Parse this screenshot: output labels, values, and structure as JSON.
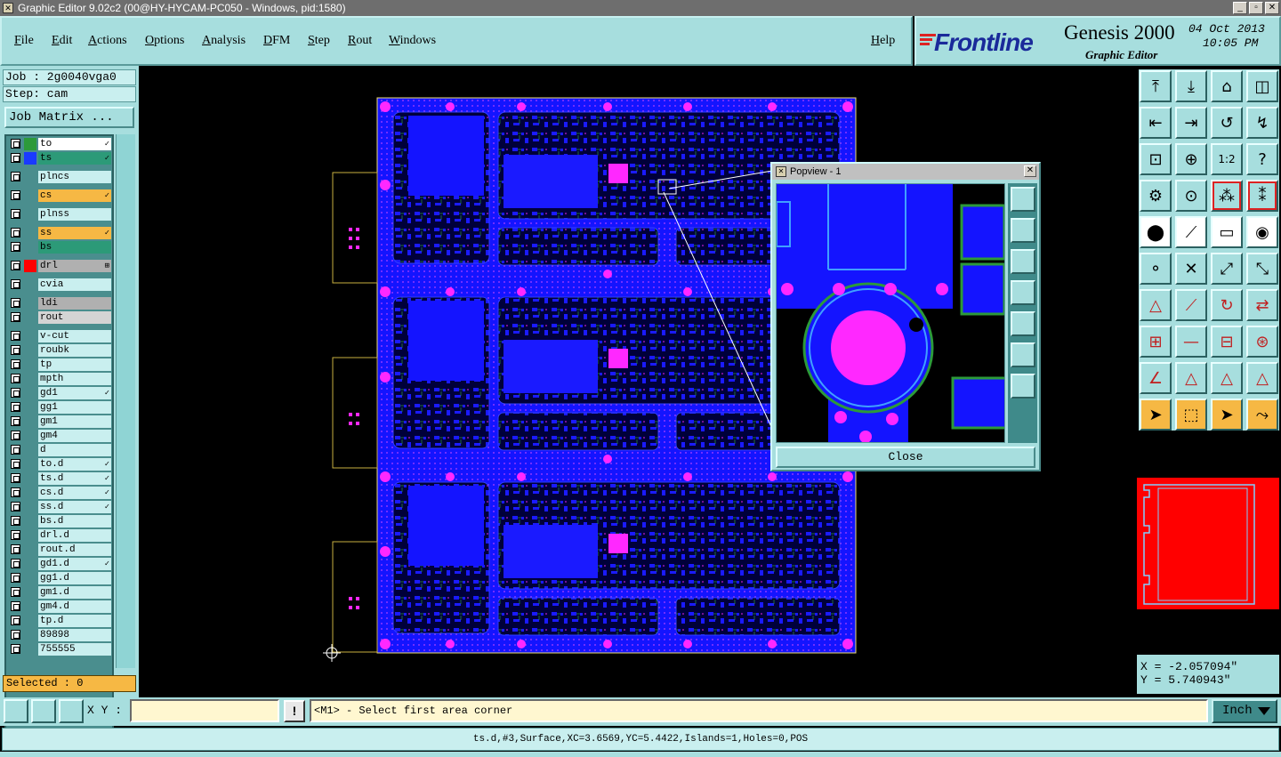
{
  "window": {
    "title": "Graphic Editor 9.02c2 (00@HY-HYCAM-PC050 - Windows, pid:1580)",
    "buttons": [
      "_",
      "▫",
      "✕"
    ]
  },
  "menu": {
    "items": [
      "File",
      "Edit",
      "Actions",
      "Options",
      "Analysis",
      "DFM",
      "Step",
      "Rout",
      "Windows"
    ],
    "help": "Help"
  },
  "brand": {
    "logo": "Frontline",
    "product": "Genesis 2000",
    "subtitle": "Graphic Editor",
    "date": "04 Oct 2013",
    "time": "10:05 PM"
  },
  "job": {
    "job_label": "Job : 2g0040vga0",
    "step_label": "Step: cam",
    "matrix_button": "Job Matrix ..."
  },
  "layers": [
    {
      "name": "to",
      "style": "white",
      "swatch": "#2c9a3a",
      "flag": "✓"
    },
    {
      "name": "ts",
      "style": "green",
      "swatch": "#1a3aff",
      "flag": "✓"
    },
    {
      "name": "plncs",
      "style": "normal",
      "swatch": "",
      "flag": ""
    },
    {
      "name": "cs",
      "style": "orange",
      "swatch": "",
      "flag": "✓"
    },
    {
      "name": "plnss",
      "style": "normal",
      "swatch": "",
      "flag": ""
    },
    {
      "name": "ss",
      "style": "orange",
      "swatch": "",
      "flag": "✓"
    },
    {
      "name": "bs",
      "style": "green",
      "swatch": "",
      "flag": ""
    },
    {
      "name": "drl",
      "style": "gray",
      "swatch": "#ff0000",
      "flag": "⊞"
    },
    {
      "name": "cvia",
      "style": "normal",
      "swatch": "",
      "flag": ""
    },
    {
      "name": "ldi",
      "style": "gray",
      "swatch": "",
      "flag": ""
    },
    {
      "name": "rout",
      "style": "lgray",
      "swatch": "",
      "flag": ""
    },
    {
      "name": "v-cut",
      "style": "normal",
      "swatch": "",
      "flag": ""
    },
    {
      "name": "roubk",
      "style": "normal",
      "swatch": "",
      "flag": ""
    },
    {
      "name": "tp",
      "style": "normal",
      "swatch": "",
      "flag": ""
    },
    {
      "name": "mpth",
      "style": "normal",
      "swatch": "",
      "flag": ""
    },
    {
      "name": "gd1",
      "style": "normal",
      "swatch": "",
      "flag": "✓"
    },
    {
      "name": "gg1",
      "style": "normal",
      "swatch": "",
      "flag": ""
    },
    {
      "name": "gm1",
      "style": "normal",
      "swatch": "",
      "flag": ""
    },
    {
      "name": "gm4",
      "style": "normal",
      "swatch": "",
      "flag": ""
    },
    {
      "name": "d",
      "style": "normal",
      "swatch": "",
      "flag": ""
    },
    {
      "name": "to.d",
      "style": "normal",
      "swatch": "",
      "flag": "✓"
    },
    {
      "name": "ts.d",
      "style": "normal",
      "swatch": "",
      "flag": "✓"
    },
    {
      "name": "cs.d",
      "style": "normal",
      "swatch": "",
      "flag": "✓"
    },
    {
      "name": "ss.d",
      "style": "normal",
      "swatch": "",
      "flag": "✓"
    },
    {
      "name": "bs.d",
      "style": "normal",
      "swatch": "",
      "flag": ""
    },
    {
      "name": "drl.d",
      "style": "normal",
      "swatch": "",
      "flag": ""
    },
    {
      "name": "rout.d",
      "style": "normal",
      "swatch": "",
      "flag": ""
    },
    {
      "name": "gd1.d",
      "style": "normal",
      "swatch": "",
      "flag": "✓"
    },
    {
      "name": "gg1.d",
      "style": "normal",
      "swatch": "",
      "flag": ""
    },
    {
      "name": "gm1.d",
      "style": "normal",
      "swatch": "",
      "flag": ""
    },
    {
      "name": "gm4.d",
      "style": "normal",
      "swatch": "",
      "flag": ""
    },
    {
      "name": "tp.d",
      "style": "normal",
      "swatch": "",
      "flag": ""
    },
    {
      "name": "89898",
      "style": "normal",
      "swatch": "",
      "flag": ""
    },
    {
      "name": "755555",
      "style": "normal",
      "swatch": "",
      "flag": ""
    }
  ],
  "selected_label": "Selected : 0",
  "popview": {
    "title": "Popview - 1",
    "close_label": "Close"
  },
  "coords": {
    "x": "X = -2.057094\"",
    "y": "Y =  5.740943\""
  },
  "command": {
    "xy_label": "X Y :",
    "xy_value": "",
    "prompt": "<M1> - Select first area corner",
    "units": "Inch"
  },
  "status": "ts.d,#3,Surface,XC=3.6569,YC=5.4422,Islands=1,Holes=0,POS",
  "colors": {
    "panel": "#a7dede",
    "board_blue": "#1414ff",
    "pad_magenta": "#ff28ff",
    "copper_green": "#2c9a3a",
    "highlight_orange": "#f6b844",
    "minimap_red": "#ff0000"
  }
}
